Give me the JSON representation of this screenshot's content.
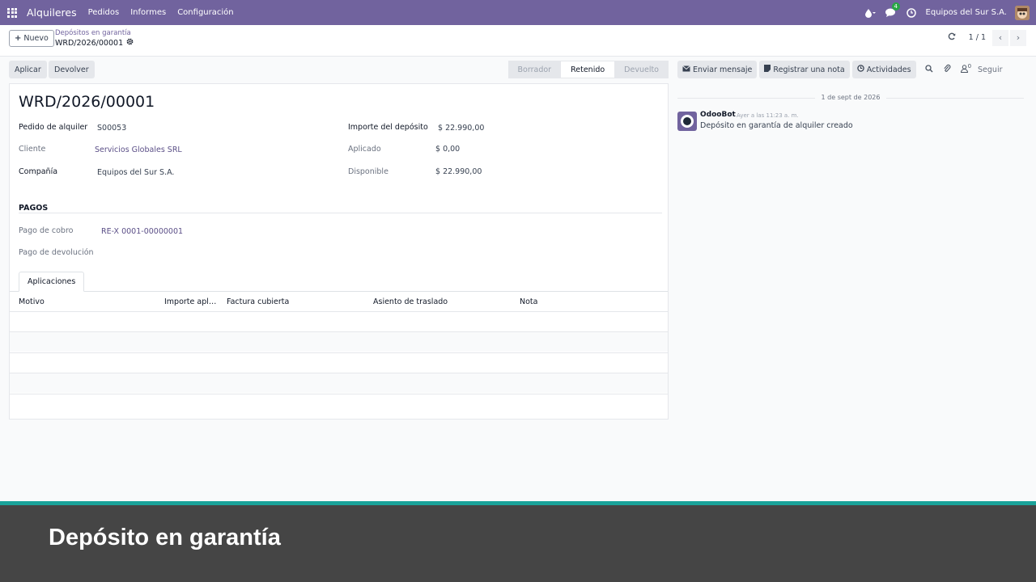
{
  "navbar": {
    "app_name": "Alquileres",
    "menu": [
      "Pedidos",
      "Informes",
      "Configuración"
    ],
    "chat_badge": "4",
    "company": "Equipos del Sur S.A.",
    "icons": [
      "apps-grid-icon",
      "droplet-icon",
      "chat-icon",
      "clock-icon"
    ]
  },
  "control_panel": {
    "new_label": "Nuevo",
    "breadcrumb": "Depósitos en garantía",
    "record_name": "WRD/2026/00001",
    "pager": "1 / 1"
  },
  "statusbar": {
    "apply_label": "Aplicar",
    "return_label": "Devolver",
    "stages": [
      {
        "label": "Borrador",
        "active": false
      },
      {
        "label": "Retenido",
        "active": true
      },
      {
        "label": "Devuelto",
        "active": false
      }
    ]
  },
  "form": {
    "title": "WRD/2026/00001",
    "left_fields": [
      {
        "label": "Pedido de alquiler",
        "value": "S00053"
      },
      {
        "label": "Cliente",
        "value": "Servicios Globales SRL"
      },
      {
        "label": "Compañía",
        "value": "Equipos del Sur S.A."
      }
    ],
    "right_fields": [
      {
        "label": "Importe del depósito",
        "value": "$ 22.990,00"
      },
      {
        "label": "Aplicado",
        "value": "$ 0,00"
      },
      {
        "label": "Disponible",
        "value": "$ 22.990,00"
      }
    ],
    "section_title": "PAGOS",
    "payment_fields": [
      {
        "label": "Pago de cobro",
        "value": "RE-X 0001-00000001"
      },
      {
        "label": "Pago de devolución",
        "value": ""
      }
    ],
    "tab_label": "Aplicaciones",
    "columns": [
      "Motivo",
      "Importe apli...",
      "Factura cubierta",
      "Asiento de traslado",
      "Nota"
    ]
  },
  "chatter": {
    "send_message": "Enviar mensaje",
    "log_note": "Registrar una nota",
    "activities": "Actividades",
    "followers_count": "0",
    "follow_label": "Seguir",
    "date_separator": "1 de sept de 2026",
    "message": {
      "author": "OdooBot",
      "date": "Ayer a las 11:23 a. m.",
      "body": "Depósito en garantía de alquiler creado"
    }
  },
  "caption": {
    "text": "Depósito en garantía"
  },
  "colors": {
    "brand": "#71639e",
    "link": "#5b4f87",
    "caption_bg": "#454545",
    "caption_accent": "#1aa39a"
  }
}
